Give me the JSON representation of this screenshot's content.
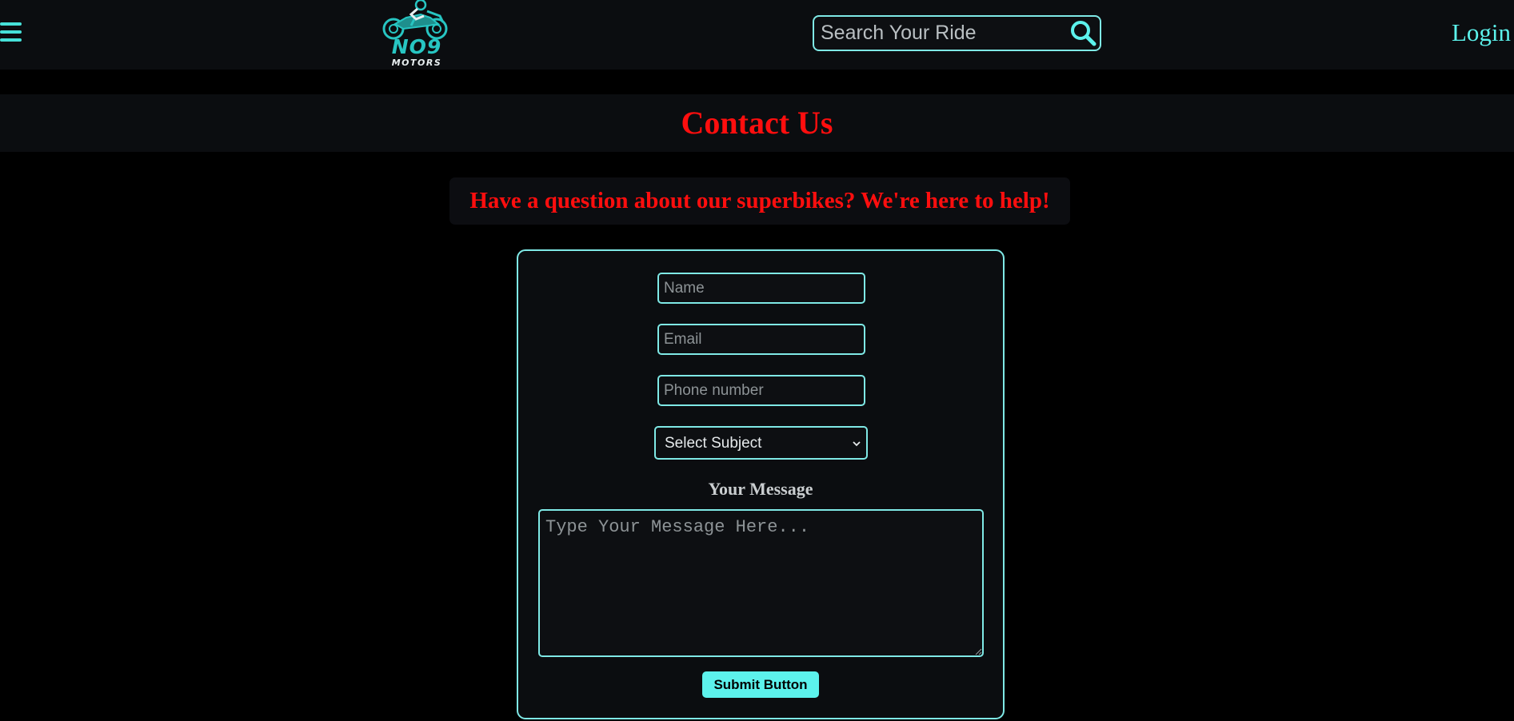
{
  "header": {
    "menu_icon": "hamburger-menu-icon",
    "logo": {
      "main_text": "NO9",
      "sub_text": "MOTORS",
      "icon": "motorcycle-rider-logo"
    },
    "search": {
      "placeholder": "Search Your Ride",
      "value": "",
      "icon": "search-icon"
    },
    "login_label": "Login"
  },
  "main": {
    "title": "Contact Us",
    "tagline": "Have a question about our superbikes? We're here to help!"
  },
  "form": {
    "name_placeholder": "Name",
    "email_placeholder": "Email",
    "phone_placeholder": "Phone number",
    "subject_selected": "Select Subject",
    "message_label": "Your Message",
    "message_placeholder": "Type Your Message Here...",
    "submit_label": "Submit Button"
  },
  "colors": {
    "accent": "#5cf2ec",
    "accent_border": "#7fe9e6",
    "headline_red": "#ff0e0e",
    "panel_bg": "#0b0d10",
    "page_bg": "#000000",
    "logo_teal": "#27c5c2"
  }
}
